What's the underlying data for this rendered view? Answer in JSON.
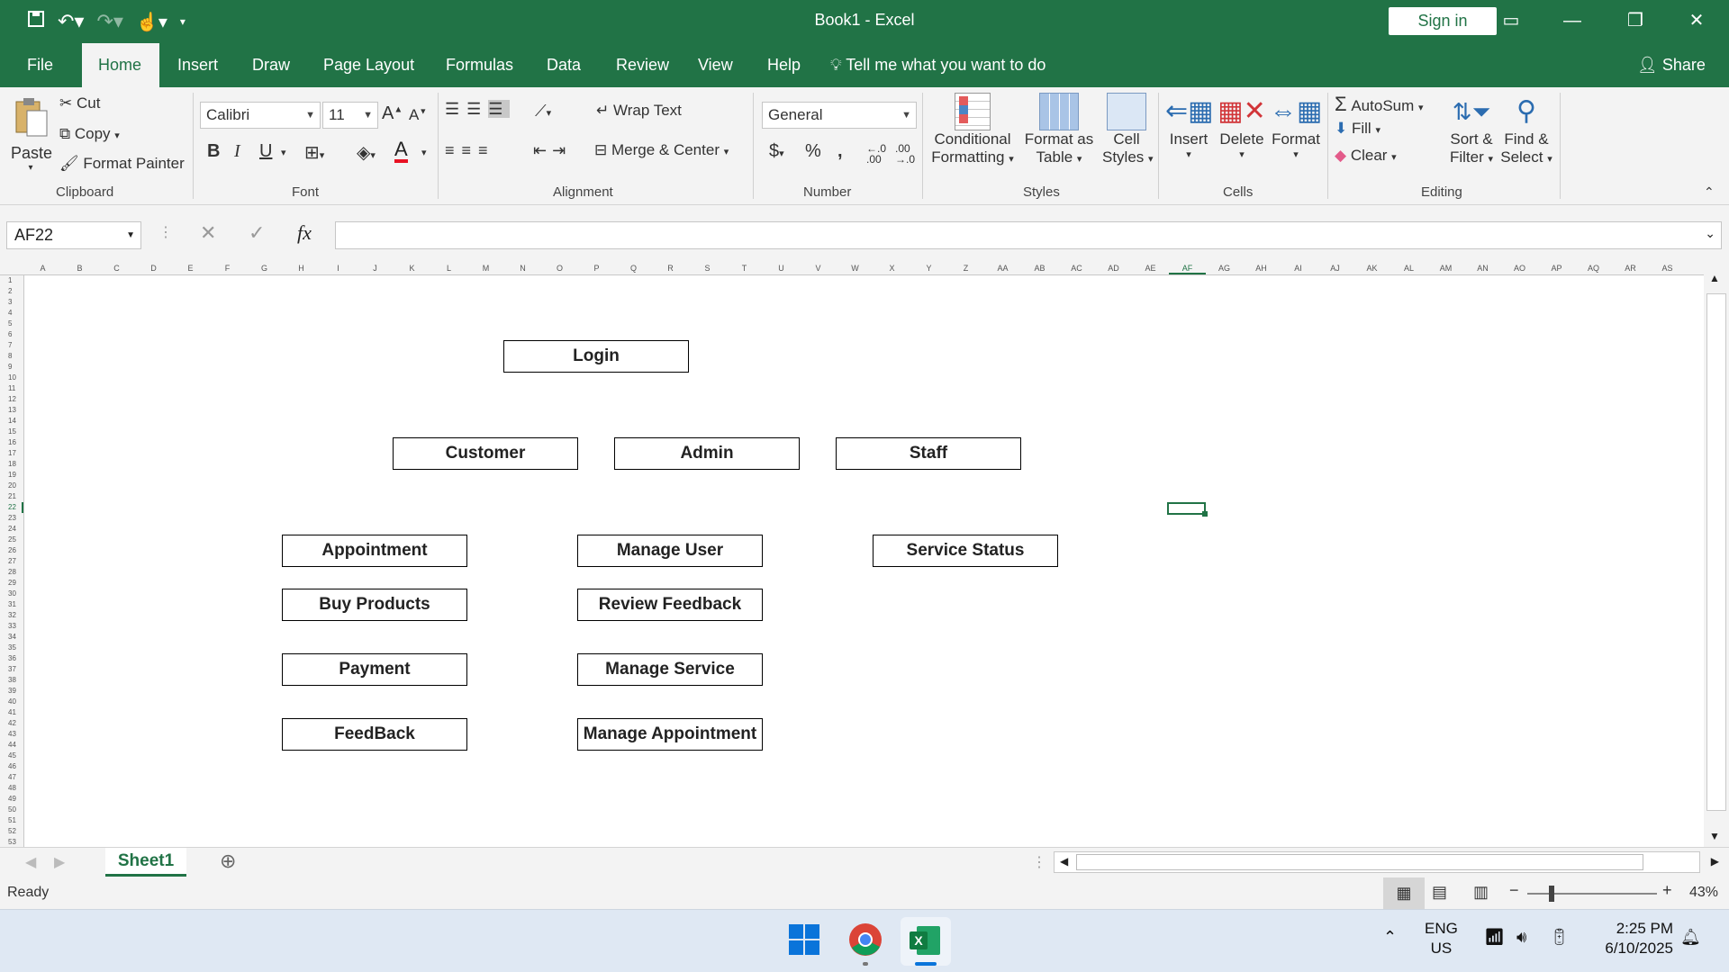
{
  "window": {
    "title": "Book1  -  Excel",
    "sign_in": "Sign in",
    "share": "Share"
  },
  "tabs": [
    "File",
    "Home",
    "Insert",
    "Draw",
    "Page Layout",
    "Formulas",
    "Data",
    "Review",
    "View",
    "Help"
  ],
  "tell_me": "Tell me what you want to do",
  "ribbon": {
    "clipboard": {
      "label": "Clipboard",
      "paste": "Paste",
      "cut": "Cut",
      "copy": "Copy",
      "format_painter": "Format Painter"
    },
    "font": {
      "label": "Font",
      "name": "Calibri",
      "size": "11",
      "bold": "B",
      "italic": "I",
      "underline": "U"
    },
    "alignment": {
      "label": "Alignment",
      "wrap": "Wrap Text",
      "merge": "Merge & Center"
    },
    "number": {
      "label": "Number",
      "format": "General"
    },
    "styles": {
      "label": "Styles",
      "conditional_1": "Conditional",
      "conditional_2": "Formatting",
      "format_as_1": "Format as",
      "format_as_2": "Table",
      "cell_1": "Cell",
      "cell_2": "Styles"
    },
    "cells": {
      "label": "Cells",
      "insert": "Insert",
      "delete": "Delete",
      "format": "Format"
    },
    "editing": {
      "label": "Editing",
      "autosum": "AutoSum",
      "fill": "Fill",
      "clear": "Clear",
      "sort_1": "Sort &",
      "sort_2": "Filter",
      "find_1": "Find &",
      "find_2": "Select"
    }
  },
  "formula_bar": {
    "name_box": "AF22",
    "fx": "fx",
    "content": ""
  },
  "columns": [
    "A",
    "B",
    "C",
    "D",
    "E",
    "F",
    "G",
    "H",
    "I",
    "J",
    "K",
    "L",
    "M",
    "N",
    "O",
    "P",
    "Q",
    "R",
    "S",
    "T",
    "U",
    "V",
    "W",
    "X",
    "Y",
    "Z",
    "AA",
    "AB",
    "AC",
    "AD",
    "AE",
    "AF",
    "AG",
    "AH",
    "AI",
    "AJ",
    "AK",
    "AL",
    "AM",
    "AN",
    "AO",
    "AP",
    "AQ",
    "AR",
    "AS"
  ],
  "row_count": 53,
  "diagram": {
    "login": "Login",
    "roles": [
      "Customer",
      "Admin",
      "Staff"
    ],
    "customer_items": [
      "Appointment",
      "Buy Products",
      "Payment",
      "FeedBack"
    ],
    "admin_items": [
      "Manage User",
      "Review Feedback",
      "Manage Service",
      "Manage Appointment"
    ],
    "staff_items": [
      "Service Status"
    ]
  },
  "sheet": {
    "name": "Sheet1"
  },
  "status": {
    "text": "Ready",
    "zoom": "43%"
  },
  "taskbar": {
    "lang_1": "ENG",
    "lang_2": "US",
    "time": "2:25 PM",
    "date": "6/10/2025"
  },
  "colors": {
    "excel_green": "#217346"
  }
}
